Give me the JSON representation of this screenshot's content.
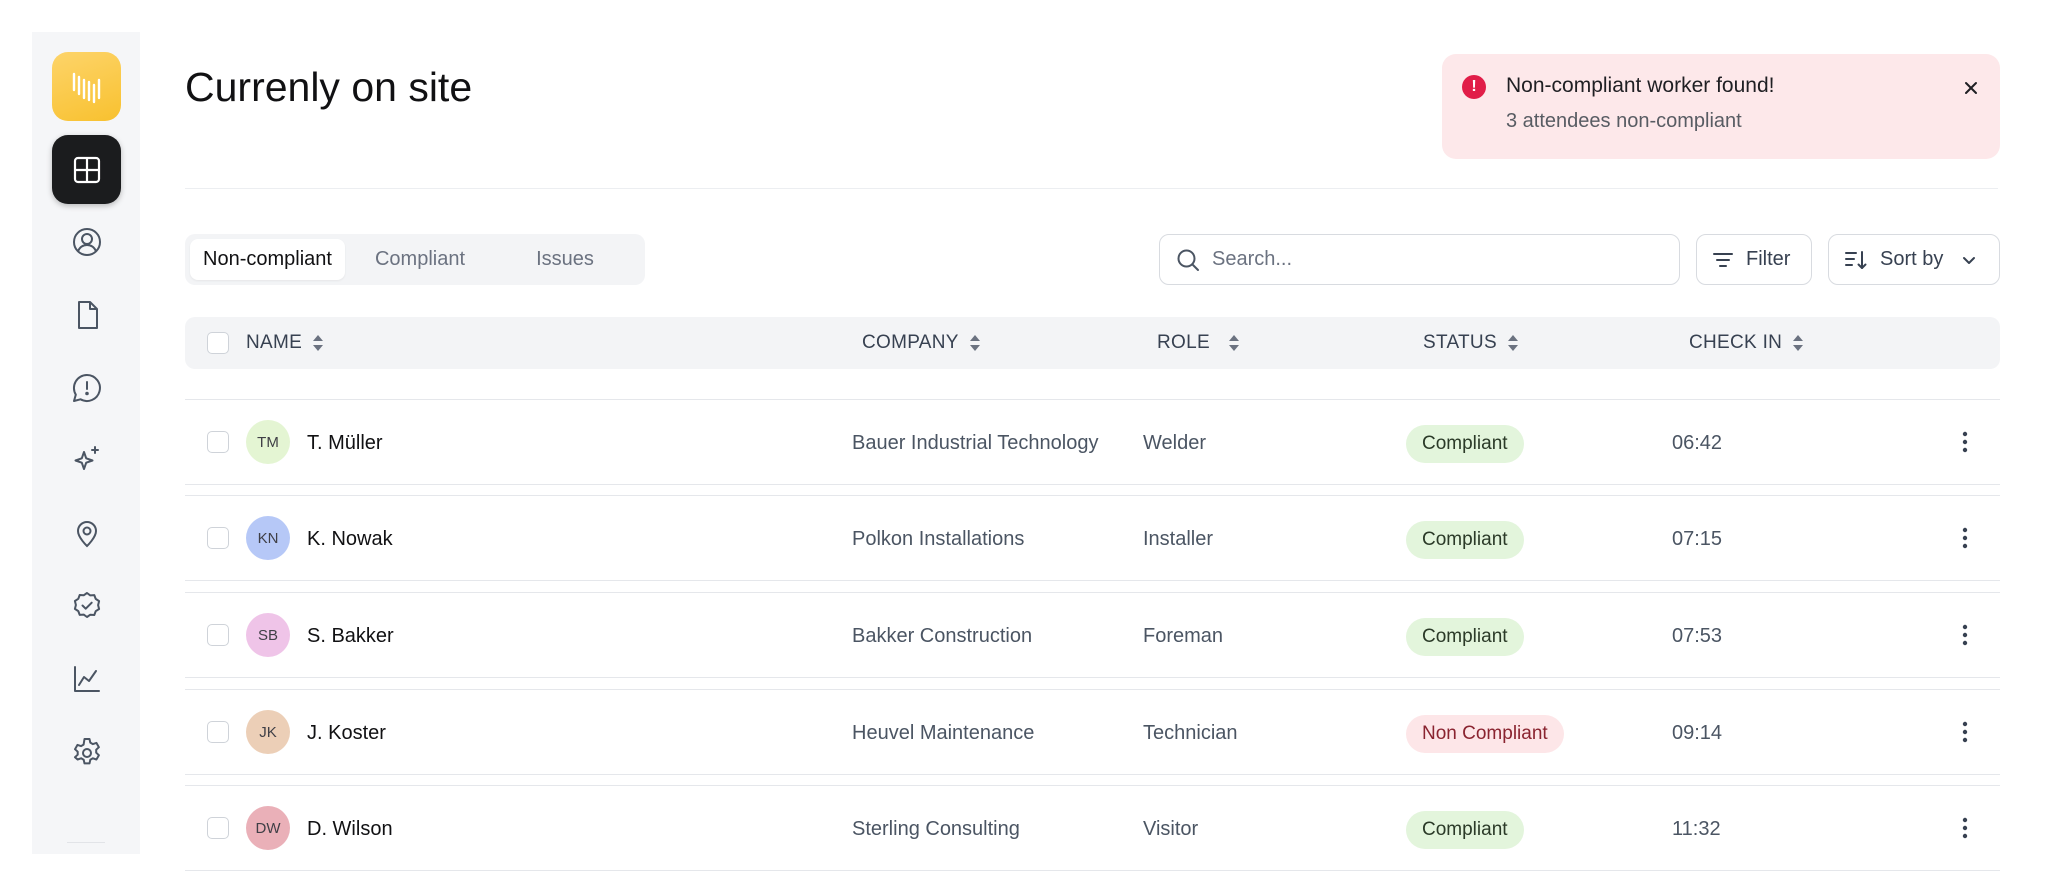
{
  "app": {
    "logo_icon": "waveform-logo-icon",
    "accent": "#f8c12f"
  },
  "sidebar": {
    "items": [
      {
        "name": "dashboard",
        "icon": "layout-grid-icon",
        "active": true
      },
      {
        "name": "people",
        "icon": "user-circle-icon",
        "active": false
      },
      {
        "name": "documents",
        "icon": "file-icon",
        "active": false
      },
      {
        "name": "messages",
        "icon": "alert-message-icon",
        "active": false
      },
      {
        "name": "ai",
        "icon": "sparkles-icon",
        "active": false
      },
      {
        "name": "locations",
        "icon": "map-pin-icon",
        "active": false
      },
      {
        "name": "compliance",
        "icon": "badge-check-icon",
        "active": false
      },
      {
        "name": "analytics",
        "icon": "line-chart-icon",
        "active": false
      },
      {
        "name": "settings",
        "icon": "gear-icon",
        "active": false
      }
    ]
  },
  "header": {
    "title": "Currenly on site"
  },
  "toast": {
    "title": "Non-compliant worker found!",
    "message": "3 attendees non-compliant",
    "color": "#e11d48"
  },
  "tabs": [
    {
      "label": "Non-compliant",
      "active": true
    },
    {
      "label": "Compliant",
      "active": false
    },
    {
      "label": "Issues",
      "active": false
    }
  ],
  "search": {
    "placeholder": "Search..."
  },
  "toolbar": {
    "filter_label": "Filter",
    "sort_label": "Sort by"
  },
  "table": {
    "columns": [
      "NAME",
      "COMPANY",
      "ROLE",
      "STATUS",
      "CHECK IN"
    ],
    "rows": [
      {
        "initials": "TM",
        "name": "T. Müller",
        "company": "Bauer Industrial Technology",
        "role": "Welder",
        "status": "Compliant",
        "compliant": true,
        "check_in": "06:42",
        "avatar_color": "#e4f5d3"
      },
      {
        "initials": "KN",
        "name": "K. Nowak",
        "company": "Polkon Installations",
        "role": "Installer",
        "status": "Compliant",
        "compliant": true,
        "check_in": "07:15",
        "avatar_color": "#b6c8f7"
      },
      {
        "initials": "SB",
        "name": "S. Bakker",
        "company": "Bakker Construction",
        "role": "Foreman",
        "status": "Compliant",
        "compliant": true,
        "check_in": "07:53",
        "avatar_color": "#efc4e8"
      },
      {
        "initials": "JK",
        "name": "J. Koster",
        "company": "Heuvel Maintenance",
        "role": "Technician",
        "status": "Non Compliant",
        "compliant": false,
        "check_in": "09:14",
        "avatar_color": "#eccfb7"
      },
      {
        "initials": "DW",
        "name": "D. Wilson",
        "company": "Sterling Consulting",
        "role": "Visitor",
        "status": "Compliant",
        "compliant": true,
        "check_in": "11:32",
        "avatar_color": "#eab0b8"
      }
    ]
  }
}
